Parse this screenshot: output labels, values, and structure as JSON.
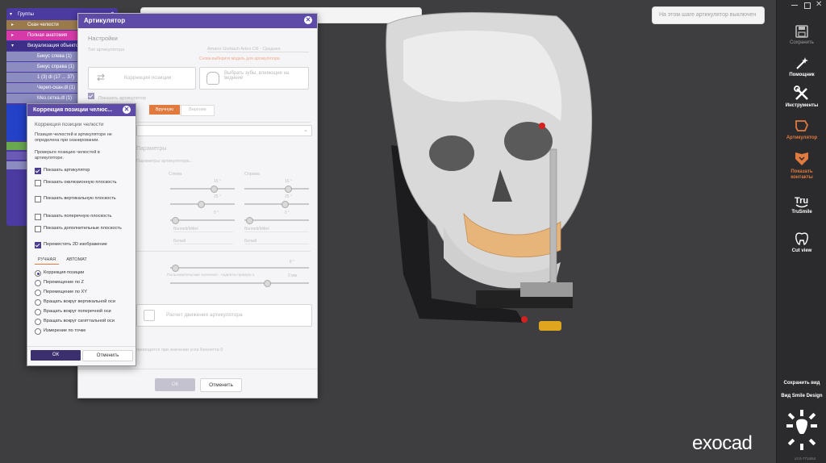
{
  "viewport": {
    "top_input_value": "",
    "notice": "На этом шаге артикулятор выключен"
  },
  "toolbar": {
    "items": [
      {
        "label": "Сохранить",
        "icon": "save-icon"
      },
      {
        "label": "Помощник",
        "icon": "magic-wand-icon"
      },
      {
        "label": "Инструменты",
        "icon": "tools-icon"
      },
      {
        "label": "Артикулятор",
        "icon": "articulator-icon"
      },
      {
        "label": "Показать контакты",
        "icon": "contacts-icon"
      },
      {
        "label": "TruSmile",
        "icon": "trusmile-icon"
      },
      {
        "label": "Cut view",
        "icon": "cut-view-icon"
      }
    ],
    "save_view": "Сохранить вид",
    "smile_design_view": "Вид Smile Design",
    "version": "v3.0-7714/64",
    "accent": "#e07a3e"
  },
  "groups": {
    "title": "Группы",
    "rows": [
      {
        "label": "Скан челюсти",
        "color": "#9a7a4a"
      },
      {
        "label": "Полная анатомия",
        "color": "#d63aa8"
      },
      {
        "label": "Визуализация объектов",
        "color": "#4b3aa0"
      },
      {
        "label": "Бикус слева (1)",
        "color": "#8c8cc0"
      },
      {
        "label": "Бикус справа (1)",
        "color": "#8c8cc0"
      },
      {
        "label": "1 (3) dl (17 ... 37)",
        "color": "#8c8cc0"
      },
      {
        "label": "Череп-скан.dl (1)",
        "color": "#8c8cc0"
      },
      {
        "label": "Мез.сетка.dl (1)",
        "color": "#8c8cc0"
      }
    ]
  },
  "articulator_dialog": {
    "title": "Артикулятор",
    "section_settings": "Настройки",
    "type_label": "Тип артикулятора",
    "type_value": "Amann Girrbach Artex CR - Среднее",
    "warning": "Снова выберите модель для артикулятора",
    "btn_position_correction": "Коррекция позиции",
    "btn_select_teeth": "Выбрать зубы, влияющие на ведение",
    "show_articulator": "Показать артикулятор",
    "tab_manual": "Вручную",
    "tab_parts": "Верхние",
    "section_params": "Параметры",
    "params_hint": "Параметры артикулятора...",
    "col_left": "Слева",
    "col_right": "Справа",
    "slider_values": [
      "15 °",
      "15 °",
      "25 °",
      "25 °",
      "0 °",
      "0 °"
    ],
    "dropdown_values": [
      "Bennett/Mittel",
      "Bennett/Mittel",
      "Белый",
      "Белый"
    ],
    "value_8": "8 °",
    "incisal_hint": "Пользовательские значения - подняты прямую о",
    "value_mm": "0 мм",
    "btn_calc": "Расчет движения артикулятора",
    "bottom_note": "проводится при значении угла Беннетта 0",
    "ok": "ОК",
    "cancel": "Отменить"
  },
  "correction_dialog": {
    "title": "Коррекция позиции челюс...",
    "subtitle": "Коррекция позиции челюсти",
    "desc": "Позиция челюстей в артикуляторе не определена при сканировании.",
    "check_hint": "Проверьте позицию челюстей в артикуляторе.",
    "checkboxes": [
      {
        "label": "Показать артикулятор",
        "checked": true
      },
      {
        "label": "Показать окклюзионную плоскость",
        "checked": false
      },
      {
        "label": "Показать вертикальную плоскость",
        "checked": false
      },
      {
        "label": "Показать поперечную плоскость",
        "checked": false
      },
      {
        "label": "Показать дополнительные плоскость",
        "checked": false
      },
      {
        "label": "Переместить 2D изображение",
        "checked": true
      }
    ],
    "tab_manual": "РУЧНАЯ",
    "tab_auto": "АВТОМАТ",
    "radios": [
      {
        "label": "Коррекция позиции",
        "checked": true
      },
      {
        "label": "Перемещение по Z",
        "checked": false
      },
      {
        "label": "Перемещение по XY",
        "checked": false
      },
      {
        "label": "Вращать вокруг вертикальной оси",
        "checked": false
      },
      {
        "label": "Вращать вокруг поперечной оси",
        "checked": false
      },
      {
        "label": "Вращать вокруг сагиттальной оси",
        "checked": false
      },
      {
        "label": "Измерение по точке",
        "checked": false
      }
    ],
    "ok": "ОК",
    "cancel": "Отменить"
  },
  "brand": "exocad",
  "colors": {
    "dialog_header": "#5e4ba7",
    "groups_bg": "#4b3aa0",
    "active_orange": "#e07a3e",
    "toolbar_bg": "#2b2b2d"
  }
}
